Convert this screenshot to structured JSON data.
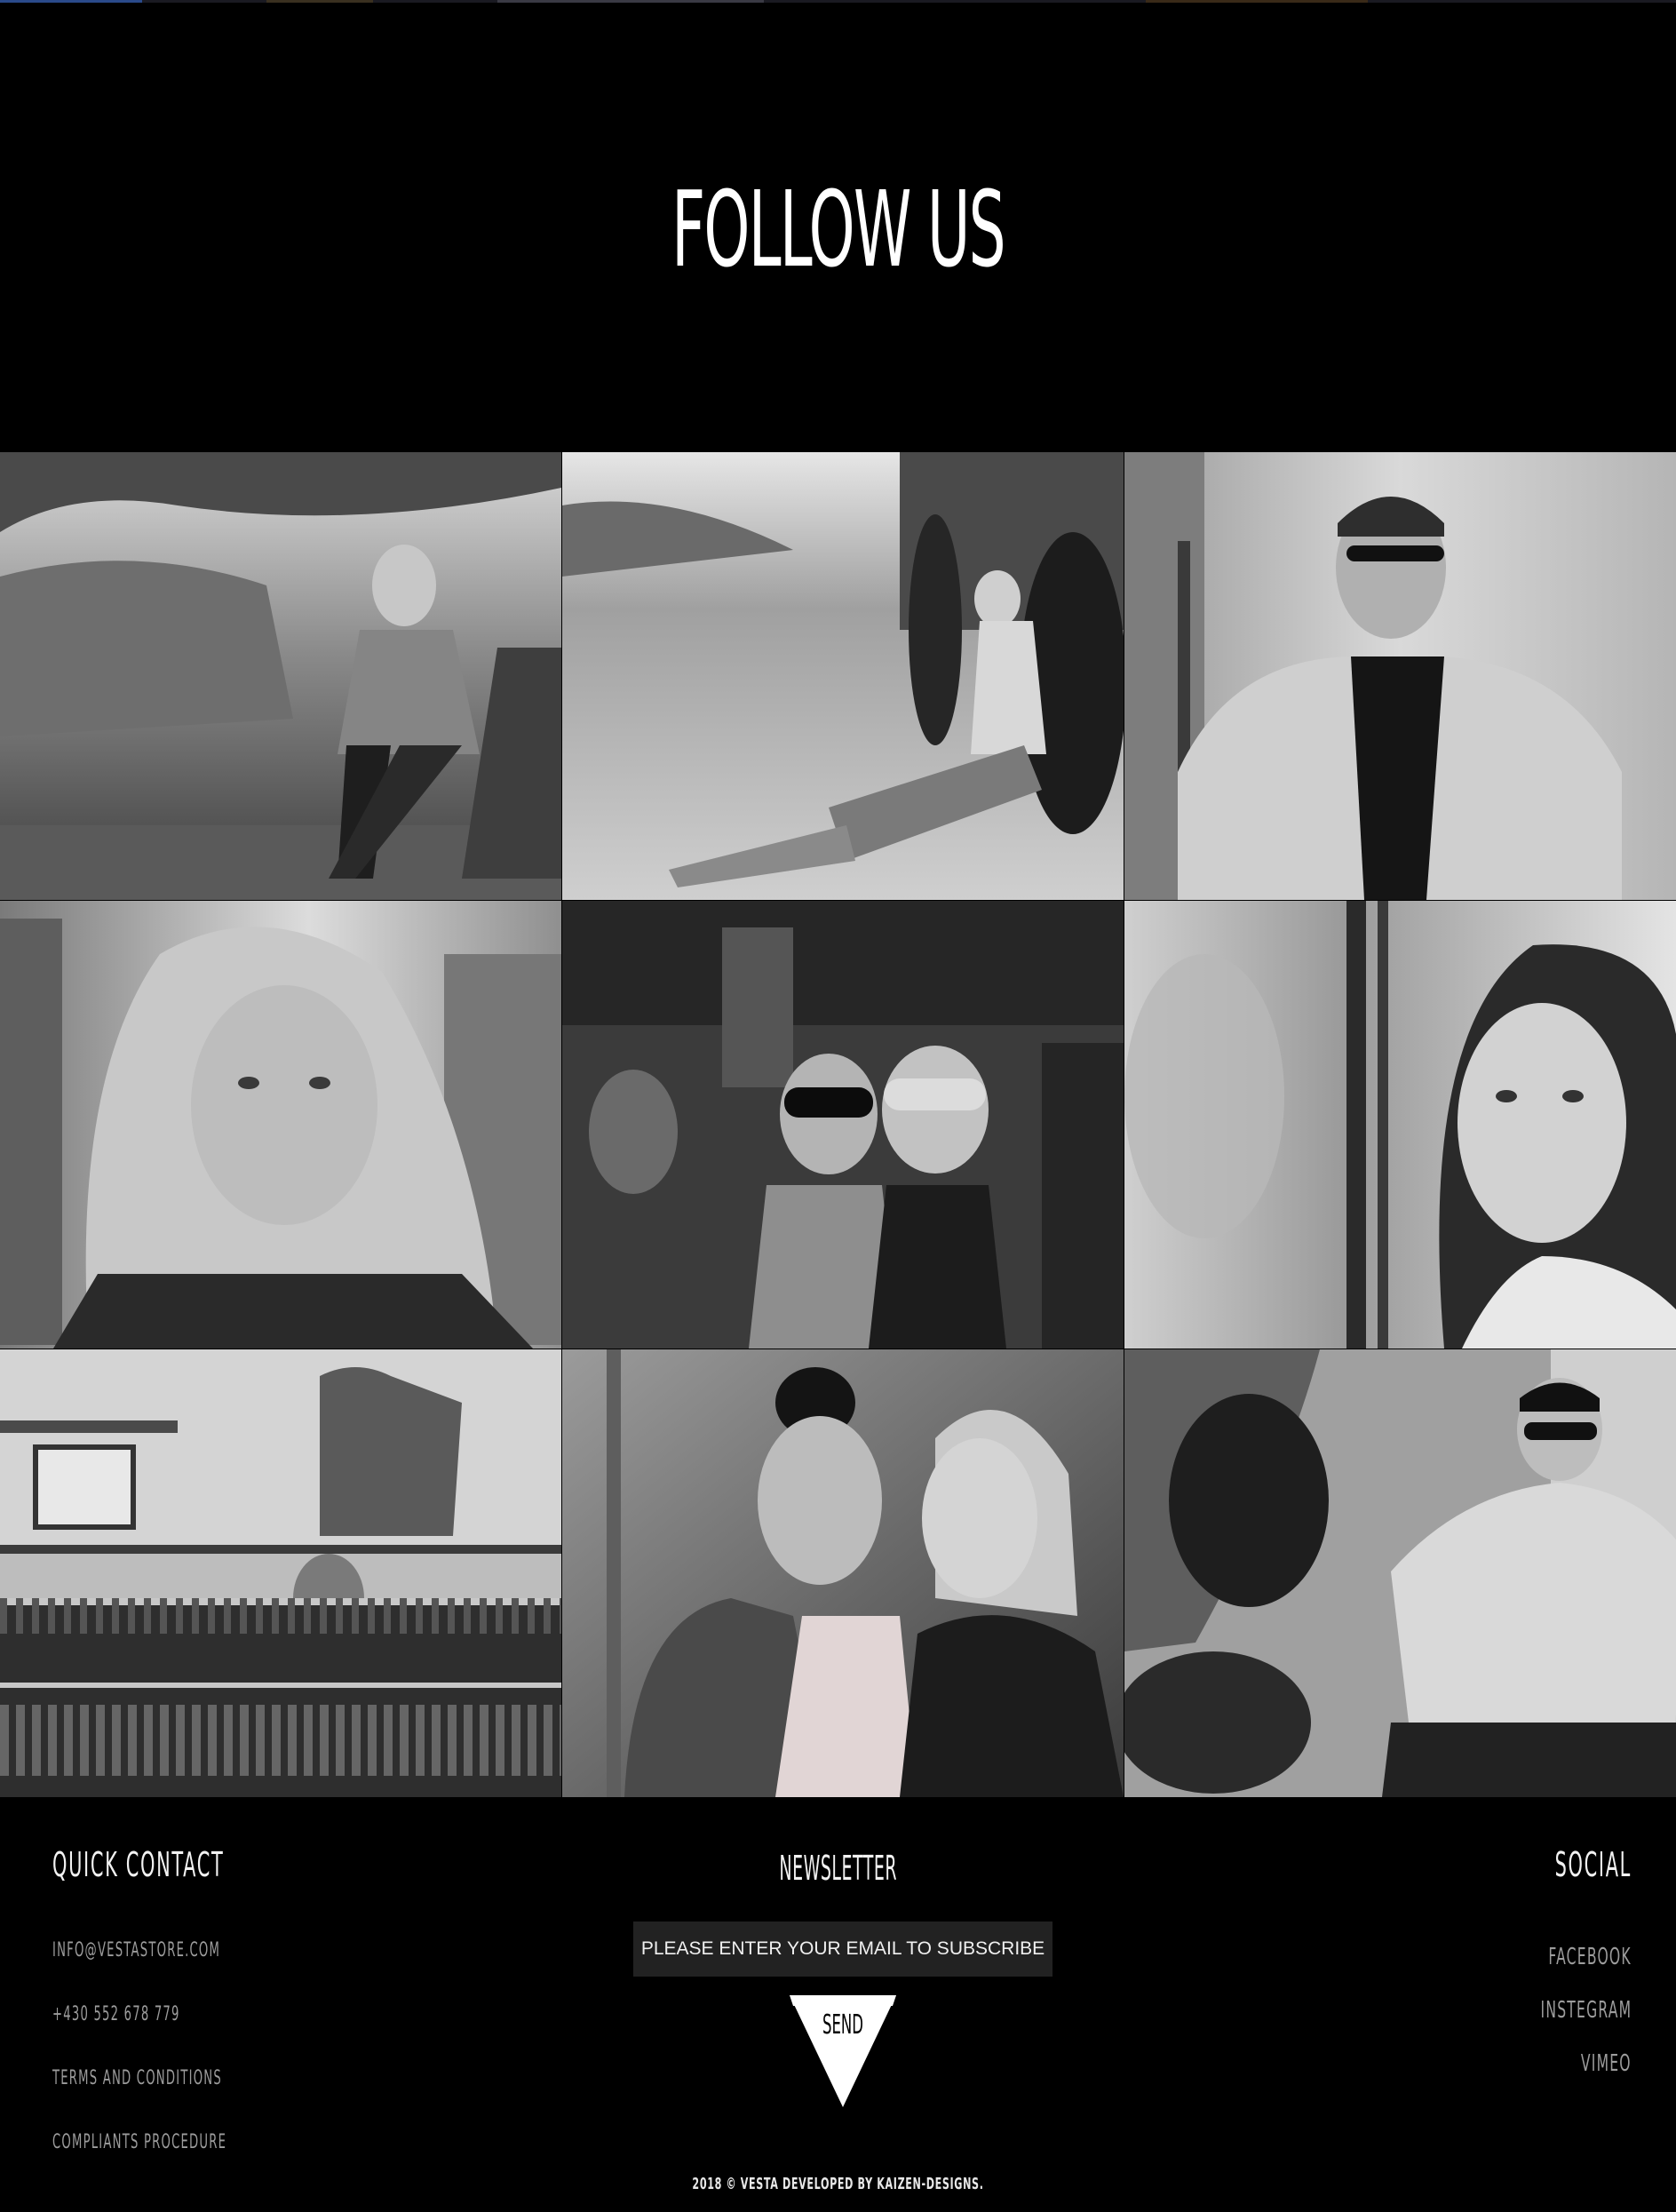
{
  "follow": {
    "title": "FOLLOW US"
  },
  "gallery": {
    "items": [
      {
        "subject": "two women sitting on a rock by the water"
      },
      {
        "subject": "woman in sunglasses sitting against a jeep wheel"
      },
      {
        "subject": "bearded man in glasses and turtleneck"
      },
      {
        "subject": "blonde woman portrait on a street"
      },
      {
        "subject": "women in masquerade masks holding champagne"
      },
      {
        "subject": "woman portrait by a window reflection"
      },
      {
        "subject": "woman browsing clothing rack in a shop"
      },
      {
        "subject": "two women posing together"
      },
      {
        "subject": "young man in sunglasses sitting outdoors"
      }
    ]
  },
  "footer": {
    "quick_contact": {
      "heading": "QUICK CONTACT",
      "email": "INFO@VESTASTORE.COM",
      "phone": "+430 552 678 779",
      "terms": "TERMS AND CONDITIONS",
      "complaints": "COMPLIANTS PROCEDURE"
    },
    "newsletter": {
      "heading": "NEWSLETTER",
      "placeholder": "PLEASE ENTER YOUR EMAIL TO SUBSCRIBE",
      "send_label": "SEND"
    },
    "social": {
      "heading": "SOCIAL",
      "links": [
        "FACEBOOK",
        "INSTEGRAM",
        "VIMEO"
      ]
    },
    "copyright": "2018 © VESTA DEVELOPED BY KAIZEN-DESIGNS."
  },
  "colors": {
    "background": "#000000",
    "link": "#9c9c9c",
    "input_bg": "#222222",
    "text": "#ffffff"
  }
}
